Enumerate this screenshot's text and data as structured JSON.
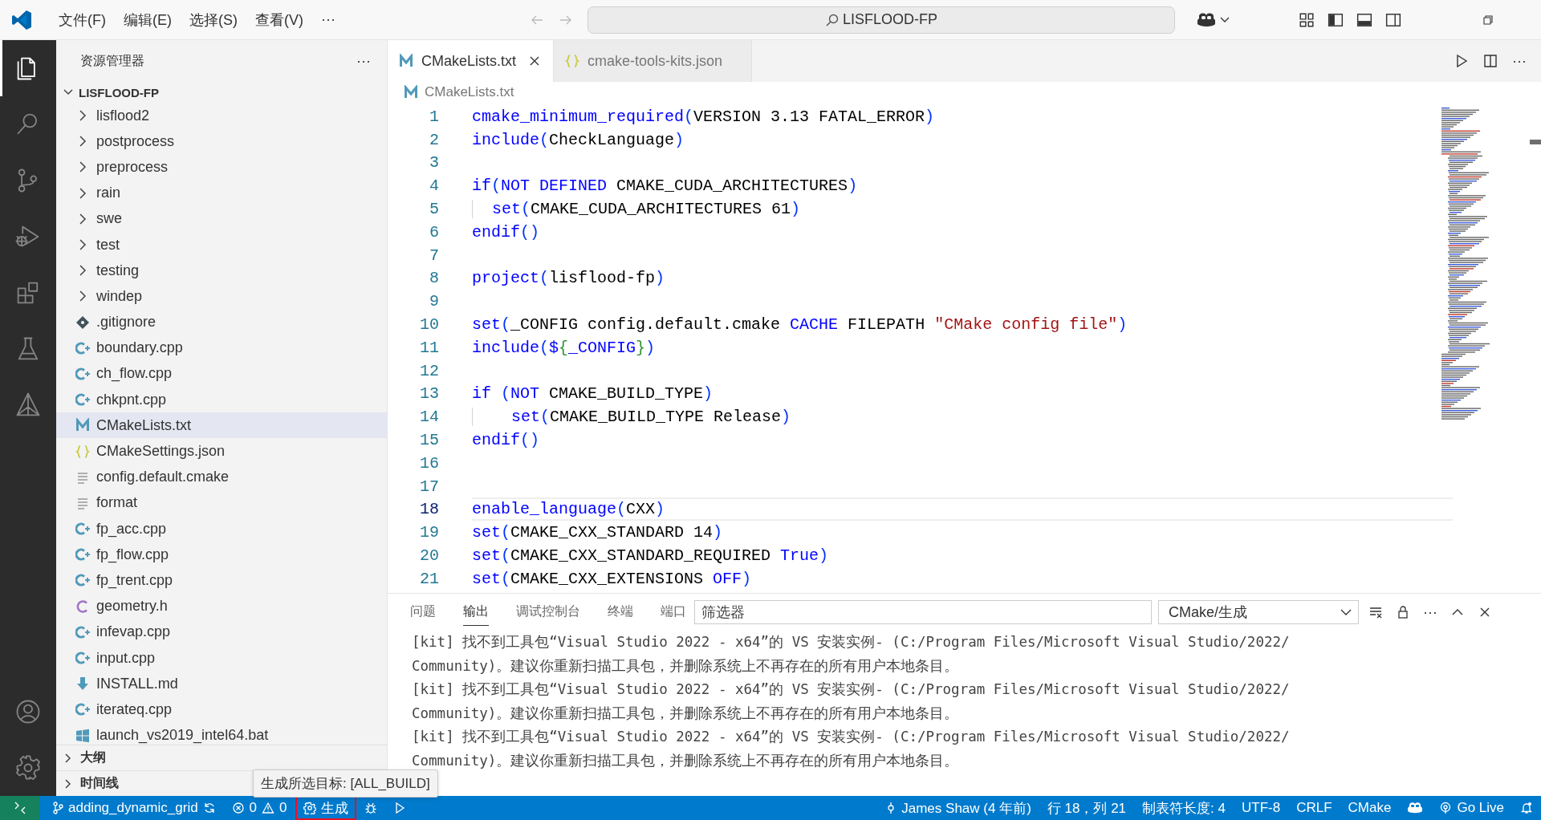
{
  "title_bar": {
    "menu": [
      "文件(F)",
      "编辑(E)",
      "选择(S)",
      "查看(V)"
    ],
    "more": "···",
    "nav": [
      {
        "kind": "back",
        "disabled": true
      },
      {
        "kind": "forward",
        "disabled": true
      }
    ],
    "search": "LISFLOOD-FP",
    "layout_buttons": [
      {
        "kind": "customize"
      },
      {
        "kind": "sidebar",
        "on": true
      },
      {
        "kind": "panel",
        "on": true
      },
      {
        "kind": "secondary",
        "on": false
      }
    ]
  },
  "activity_bar": {
    "top": [
      {
        "kind": "explorer",
        "selected": true
      },
      {
        "kind": "search",
        "selected": false
      },
      {
        "kind": "source-control",
        "selected": false
      },
      {
        "kind": "run-debug",
        "selected": false
      },
      {
        "kind": "extensions",
        "selected": false
      },
      {
        "kind": "testing",
        "selected": false
      },
      {
        "kind": "cmake",
        "selected": false
      }
    ],
    "bottom": [
      {
        "kind": "account"
      },
      {
        "kind": "settings"
      }
    ]
  },
  "sidebar": {
    "title": "资源管理器",
    "more": "···",
    "root": {
      "label": "LISFLOOD-FP",
      "expanded": true
    },
    "items": [
      {
        "label": "lisflood2",
        "kind": "folder",
        "selected": false
      },
      {
        "label": "postprocess",
        "kind": "folder",
        "selected": false
      },
      {
        "label": "preprocess",
        "kind": "folder",
        "selected": false
      },
      {
        "label": "rain",
        "kind": "folder",
        "selected": false
      },
      {
        "label": "swe",
        "kind": "folder",
        "selected": false
      },
      {
        "label": "test",
        "kind": "folder",
        "selected": false
      },
      {
        "label": "testing",
        "kind": "folder",
        "selected": false
      },
      {
        "label": "windep",
        "kind": "folder",
        "selected": false
      },
      {
        "label": ".gitignore",
        "kind": "git",
        "selected": false
      },
      {
        "label": "boundary.cpp",
        "kind": "cpp",
        "selected": false
      },
      {
        "label": "ch_flow.cpp",
        "kind": "cpp",
        "selected": false
      },
      {
        "label": "chkpnt.cpp",
        "kind": "cpp",
        "selected": false
      },
      {
        "label": "CMakeLists.txt",
        "kind": "cmake",
        "selected": true
      },
      {
        "label": "CMakeSettings.json",
        "kind": "json",
        "selected": false
      },
      {
        "label": "config.default.cmake",
        "kind": "text",
        "selected": false
      },
      {
        "label": "format",
        "kind": "text",
        "selected": false
      },
      {
        "label": "fp_acc.cpp",
        "kind": "cpp",
        "selected": false
      },
      {
        "label": "fp_flow.cpp",
        "kind": "cpp",
        "selected": false
      },
      {
        "label": "fp_trent.cpp",
        "kind": "cpp",
        "selected": false
      },
      {
        "label": "geometry.h",
        "kind": "c",
        "selected": false
      },
      {
        "label": "infevap.cpp",
        "kind": "cpp",
        "selected": false
      },
      {
        "label": "input.cpp",
        "kind": "cpp",
        "selected": false
      },
      {
        "label": "INSTALL.md",
        "kind": "md",
        "selected": false
      },
      {
        "label": "iterateq.cpp",
        "kind": "cpp",
        "selected": false
      },
      {
        "label": "launch_vs2019_intel64.bat",
        "kind": "bat",
        "selected": false
      }
    ],
    "sections": [
      {
        "label": "大纲",
        "expanded": false
      },
      {
        "label": "时间线",
        "expanded": false
      }
    ]
  },
  "editor": {
    "tabs": [
      {
        "label": "CMakeLists.txt",
        "kind": "cmake",
        "selected": true
      },
      {
        "label": "cmake-tools-kits.json",
        "kind": "json",
        "selected": false
      }
    ],
    "more": "···",
    "breadcrumb": {
      "label": "CMakeLists.txt",
      "kind": "cmake"
    },
    "lines": [
      {
        "number": "1",
        "current": false,
        "tokens": [
          {
            "kind": "function",
            "text": "cmake_minimum_required"
          },
          {
            "kind": "paren",
            "text": "("
          },
          {
            "kind": "plain",
            "text": "VERSION 3.13 FATAL_ERROR"
          },
          {
            "kind": "paren",
            "text": ")"
          }
        ]
      },
      {
        "number": "2",
        "current": false,
        "tokens": [
          {
            "kind": "function",
            "text": "include"
          },
          {
            "kind": "paren",
            "text": "("
          },
          {
            "kind": "plain",
            "text": "CheckLanguage"
          },
          {
            "kind": "paren",
            "text": ")"
          }
        ]
      },
      {
        "number": "3",
        "current": false
      },
      {
        "number": "4",
        "current": false,
        "tokens": [
          {
            "kind": "function",
            "text": "if"
          },
          {
            "kind": "paren",
            "text": "("
          },
          {
            "kind": "keyword",
            "text": "NOT DEFINED"
          },
          {
            "kind": "plain",
            "text": " CMAKE_CUDA_ARCHITECTURES"
          },
          {
            "kind": "paren",
            "text": ")"
          }
        ]
      },
      {
        "number": "5",
        "current": false,
        "guide": true,
        "tokens": [
          {
            "kind": "function",
            "text": "set"
          },
          {
            "kind": "paren",
            "text": "("
          },
          {
            "kind": "plain",
            "text": "CMAKE_CUDA_ARCHITECTURES 61"
          },
          {
            "kind": "paren",
            "text": ")"
          }
        ]
      },
      {
        "number": "6",
        "current": false,
        "tokens": [
          {
            "kind": "function",
            "text": "endif"
          },
          {
            "kind": "paren",
            "text": "()"
          }
        ]
      },
      {
        "number": "7",
        "current": false
      },
      {
        "number": "8",
        "current": false,
        "tokens": [
          {
            "kind": "function",
            "text": "project"
          },
          {
            "kind": "paren",
            "text": "("
          },
          {
            "kind": "plain",
            "text": "lisflood-fp"
          },
          {
            "kind": "paren",
            "text": ")"
          }
        ]
      },
      {
        "number": "9",
        "current": false
      },
      {
        "number": "10",
        "current": false,
        "tokens": [
          {
            "kind": "function",
            "text": "set"
          },
          {
            "kind": "paren",
            "text": "("
          },
          {
            "kind": "plain",
            "text": "_CONFIG config.default.cmake "
          },
          {
            "kind": "keyword",
            "text": "CACHE"
          },
          {
            "kind": "plain",
            "text": " FILEPATH "
          },
          {
            "kind": "string",
            "text": "\"CMake config file\""
          },
          {
            "kind": "paren",
            "text": ")"
          }
        ]
      },
      {
        "number": "11",
        "current": false,
        "tokens": [
          {
            "kind": "function",
            "text": "include"
          },
          {
            "kind": "paren",
            "text": "("
          },
          {
            "kind": "keyword",
            "text": "$"
          },
          {
            "kind": "brace",
            "text": "{"
          },
          {
            "kind": "keyword",
            "text": "_CONFIG"
          },
          {
            "kind": "brace",
            "text": "}"
          },
          {
            "kind": "paren",
            "text": ")"
          }
        ]
      },
      {
        "number": "12",
        "current": false
      },
      {
        "number": "13",
        "current": false,
        "tokens": [
          {
            "kind": "function",
            "text": "if "
          },
          {
            "kind": "paren",
            "text": "("
          },
          {
            "kind": "keyword",
            "text": "NOT"
          },
          {
            "kind": "plain",
            "text": " CMAKE_BUILD_TYPE"
          },
          {
            "kind": "paren",
            "text": ")"
          }
        ]
      },
      {
        "number": "14",
        "current": false,
        "guide": true,
        "tokens": [
          {
            "kind": "function",
            "text": "  set"
          },
          {
            "kind": "paren",
            "text": "("
          },
          {
            "kind": "plain",
            "text": "CMAKE_BUILD_TYPE Release"
          },
          {
            "kind": "paren",
            "text": ")"
          }
        ]
      },
      {
        "number": "15",
        "current": false,
        "tokens": [
          {
            "kind": "function",
            "text": "endif"
          },
          {
            "kind": "paren",
            "text": "()"
          }
        ]
      },
      {
        "number": "16",
        "current": false
      },
      {
        "number": "17",
        "current": false
      },
      {
        "number": "18",
        "current": true,
        "tokens": [
          {
            "kind": "function",
            "text": "enable_language"
          },
          {
            "kind": "paren",
            "text": "("
          },
          {
            "kind": "plain",
            "text": "CXX"
          },
          {
            "kind": "paren",
            "text": ")"
          }
        ]
      },
      {
        "number": "19",
        "current": false,
        "tokens": [
          {
            "kind": "function",
            "text": "set"
          },
          {
            "kind": "paren",
            "text": "("
          },
          {
            "kind": "plain",
            "text": "CMAKE_CXX_STANDARD 14"
          },
          {
            "kind": "paren",
            "text": ")"
          }
        ]
      },
      {
        "number": "20",
        "current": false,
        "tokens": [
          {
            "kind": "function",
            "text": "set"
          },
          {
            "kind": "paren",
            "text": "("
          },
          {
            "kind": "plain",
            "text": "CMAKE_CXX_STANDARD_REQUIRED "
          },
          {
            "kind": "keyword",
            "text": "True"
          },
          {
            "kind": "paren",
            "text": ")"
          }
        ]
      },
      {
        "number": "21",
        "current": false,
        "tokens": [
          {
            "kind": "function",
            "text": "set"
          },
          {
            "kind": "paren",
            "text": "("
          },
          {
            "kind": "plain",
            "text": "CMAKE_CXX_EXTENSIONS "
          },
          {
            "kind": "keyword",
            "text": "OFF"
          },
          {
            "kind": "paren",
            "text": ")"
          }
        ]
      }
    ]
  },
  "panel": {
    "tabs": [
      {
        "label": "问题",
        "selected": false
      },
      {
        "label": "输出",
        "selected": true
      },
      {
        "label": "调试控制台",
        "selected": false
      },
      {
        "label": "终端",
        "selected": false
      },
      {
        "label": "端口",
        "selected": false
      }
    ],
    "filter": {
      "placeholder": "筛选器"
    },
    "channel": "CMake/生成",
    "more": "···",
    "output": [
      "[kit] 找不到工具包“Visual Studio 2022 - x64”的 VS 安装实例- (C:/Program Files/Microsoft Visual Studio/2022/",
      "Community)。建议你重新扫描工具包，并删除系统上不再存在的所有用户本地条目。",
      "[kit] 找不到工具包“Visual Studio 2022 - x64”的 VS 安装实例- (C:/Program Files/Microsoft Visual Studio/2022/",
      "Community)。建议你重新扫描工具包，并删除系统上不再存在的所有用户本地条目。",
      "[kit] 找不到工具包“Visual Studio 2022 - x64”的 VS 安装实例- (C:/Program Files/Microsoft Visual Studio/2022/",
      "Community)。建议你重新扫描工具包，并删除系统上不再存在的所有用户本地条目。"
    ]
  },
  "tooltip": "生成所选目标: [ALL_BUILD]",
  "status_bar": {
    "left": [
      {
        "kind": "remote"
      },
      {
        "kind": "branch",
        "text": "adding_dynamic_grid"
      },
      {
        "kind": "problems",
        "errors": "0",
        "warnings": "0"
      },
      {
        "kind": "build",
        "text": "生成",
        "highlighted": true
      },
      {
        "kind": "debug"
      },
      {
        "kind": "run"
      }
    ],
    "right": [
      {
        "kind": "blame",
        "text": "James Shaw (4 年前)"
      },
      {
        "kind": "plain",
        "text": "行 18，列 21"
      },
      {
        "kind": "plain",
        "text": "制表符长度: 4"
      },
      {
        "kind": "plain",
        "text": "UTF-8"
      },
      {
        "kind": "plain",
        "text": "CRLF"
      },
      {
        "kind": "plain",
        "text": "CMake"
      },
      {
        "kind": "copilot"
      },
      {
        "kind": "golive",
        "text": "Go Live"
      },
      {
        "kind": "bell"
      }
    ]
  }
}
